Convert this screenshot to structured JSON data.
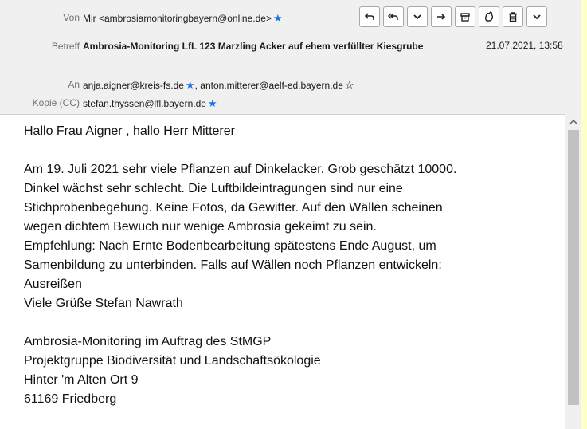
{
  "header": {
    "from_label": "Von",
    "from_value": "Mir <ambrosiamonitoringbayern@online.de>",
    "subject_label": "Betreff",
    "subject_value": "Ambrosia-Monitoring LfL 123 Marzling Acker auf ehem verfüllter Kiesgrube",
    "date": "21.07.2021, 13:58",
    "to_label": "An",
    "to_1": "anja.aigner@kreis-fs.de",
    "to_sep": ",",
    "to_2": "anton.mitterer@aelf-ed.bayern.de",
    "cc_label": "Kopie (CC)",
    "cc_value": "stefan.thyssen@lfl.bayern.de"
  },
  "toolbar": {
    "buttons": [
      "reply-icon",
      "reply-all-icon",
      "dropdown-icon",
      "forward-icon",
      "archive-icon",
      "junk-icon",
      "delete-icon",
      "more-icon"
    ]
  },
  "body": {
    "greeting": "Hallo Frau Aigner , hallo Herr Mitterer",
    "p1_l1": "Am 19. Juli 2021 sehr viele Pflanzen auf Dinkelacker. Grob geschätzt 10000.",
    "p1_l2": "Dinkel wächst sehr schlecht. Die Luftbildeintragungen sind nur eine",
    "p1_l3": "Stichprobenbegehung. Keine Fotos, da Gewitter. Auf den Wällen scheinen",
    "p1_l4": "wegen dichtem Bewuch nur wenige Ambrosia gekeimt zu sein.",
    "p1_l5": "Empfehlung: Nach Ernte Bodenbearbeitung spätestens Ende August, um",
    "p1_l6": "Samenbildung zu unterbinden. Falls auf Wällen noch Pflanzen entwickeln:",
    "p1_l7": "Ausreißen",
    "p1_l8": "Viele Grüße Stefan Nawrath",
    "sig_l1": "Ambrosia-Monitoring im Auftrag des StMGP",
    "sig_l2": "Projektgruppe Biodiversität und Landschaftsökologie",
    "sig_l3": "Hinter 'm Alten Ort 9",
    "sig_l4": "61169 Friedberg"
  },
  "colors": {
    "outer_background": "#fffec8",
    "header_background": "#f0f0f0",
    "star": "#1a73e8"
  }
}
